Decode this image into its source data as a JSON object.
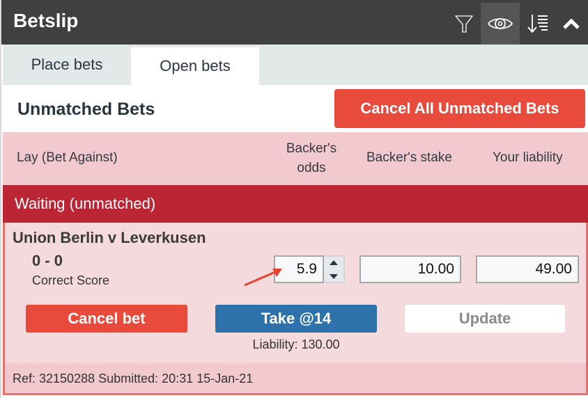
{
  "header": {
    "title": "Betslip",
    "icons": [
      "filter-icon",
      "eye-icon",
      "sort-descending-icon",
      "chevron-up-icon"
    ]
  },
  "tabs": [
    {
      "label": "Place bets",
      "active": false
    },
    {
      "label": "Open bets",
      "active": true
    }
  ],
  "unmatched": {
    "title": "Unmatched Bets",
    "cancel_all_label": "Cancel All Unmatched Bets"
  },
  "columns": {
    "lay": "Lay (Bet Against)",
    "odds_line1": "Backer's",
    "odds_line2": "odds",
    "stake": "Backer's stake",
    "liability": "Your liability"
  },
  "status": {
    "label": "Waiting (unmatched)"
  },
  "bet": {
    "event": "Union Berlin v Leverkusen",
    "selection": "0 - 0",
    "market": "Correct Score",
    "odds": "5.9",
    "stake": "10.00",
    "liability": "49.00",
    "cancel_label": "Cancel bet",
    "take_label": "Take @14",
    "update_label": "Update",
    "take_liability": "Liability: 130.00",
    "ref": "Ref: 32150288 Submitted: 20:31 15-Jan-21"
  },
  "colors": {
    "header_bg": "#404040",
    "accent_red": "#e84b3c",
    "status_red": "#bc2534",
    "take_blue": "#2e72ac",
    "card_pink": "#f4d9dd",
    "card_border": "#ee6e6b"
  }
}
